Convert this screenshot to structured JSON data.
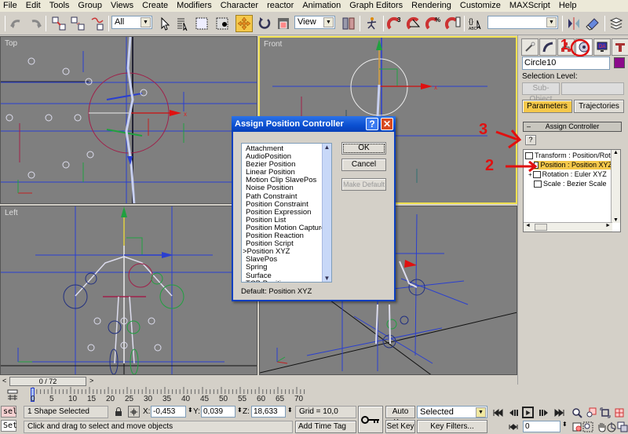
{
  "menu": [
    "File",
    "Edit",
    "Tools",
    "Group",
    "Views",
    "Create",
    "Modifiers",
    "Character",
    "reactor",
    "Animation",
    "Graph Editors",
    "Rendering",
    "Customize",
    "MAXScript",
    "Help"
  ],
  "toolbar": {
    "selection_filter": "All",
    "ref_coord": "View",
    "named_selection": "",
    "icons": [
      "undo-icon",
      "redo-icon",
      "select-link-icon",
      "unlink-icon",
      "bind-space-warp-icon",
      "select-object-icon",
      "select-by-name-icon",
      "rect-region-icon",
      "window-crossing-icon",
      "select-move-icon",
      "select-rotate-icon",
      "select-scale-icon",
      "pivot-icon",
      "manipulate-icon",
      "snap-3d-icon",
      "angle-snap-icon",
      "percent-snap-icon",
      "spinner-snap-icon",
      "edit-named-selection-icon",
      "mirror-icon",
      "align-icon",
      "layer-manager-icon"
    ]
  },
  "viewports": [
    {
      "label": "Top"
    },
    {
      "label": "Front"
    },
    {
      "label": "Left"
    },
    {
      "label": ""
    }
  ],
  "command_panel": {
    "tabs": [
      "create-tab",
      "modify-tab",
      "hierarchy-tab",
      "motion-tab",
      "display-tab",
      "utilities-tab"
    ],
    "object_name": "Circle10",
    "object_color": "#8b0a8b",
    "selection_level_label": "Selection Level:",
    "subobject_label": "Sub-Object",
    "parameters_label": "Parameters",
    "trajectories_label": "Trajectories",
    "assign_controller_header": "Assign Controller",
    "assign_button": "?",
    "tree": [
      {
        "label": "Transform : Position/Rot",
        "selected": false
      },
      {
        "label": "Position : Position XYZ",
        "selected": true
      },
      {
        "label": "Rotation : Euler XYZ",
        "selected": false
      },
      {
        "label": "Scale : Bezier Scale",
        "selected": false
      }
    ]
  },
  "dialog": {
    "title": "Assign Position Controller",
    "items": [
      "Attachment",
      "AudioPosition",
      "Bezier Position",
      "Linear Position",
      "Motion Clip SlavePos",
      "Noise Position",
      "Path Constraint",
      "Position Constraint",
      "Position Expression",
      "Position List",
      "Position Motion Capture",
      "Position Reaction",
      "Position Script",
      ">Position XYZ",
      "SlavePos",
      "Spring",
      "Surface",
      "TCB Position"
    ],
    "ok": "OK",
    "cancel": "Cancel",
    "make_default": "Make Default",
    "default_text": "Default:  Position XYZ"
  },
  "annotations": [
    "1",
    "2",
    "3"
  ],
  "timeline": {
    "slider": "0 / 72",
    "prev": "<",
    "next": ">",
    "ticks": [
      "0",
      "5",
      "10",
      "15",
      "20",
      "25",
      "30",
      "35",
      "40",
      "45",
      "50",
      "55",
      "60",
      "65",
      "70"
    ]
  },
  "status": {
    "sel_label": "sel",
    "set_label": "Set",
    "selection": "1 Shape Selected",
    "prompt": "Click and drag to select and move objects",
    "x_label": "X:",
    "x": "-0,453",
    "y_label": "Y:",
    "y": "0,039",
    "z_label": "Z:",
    "z": "18,633",
    "grid": "Grid = 10,0",
    "add_time_tag": "Add Time Tag",
    "auto_key": "Auto Key",
    "set_key": "Set Key",
    "key_mode": "Selected",
    "key_filters": "Key Filters...",
    "frame": "0"
  }
}
